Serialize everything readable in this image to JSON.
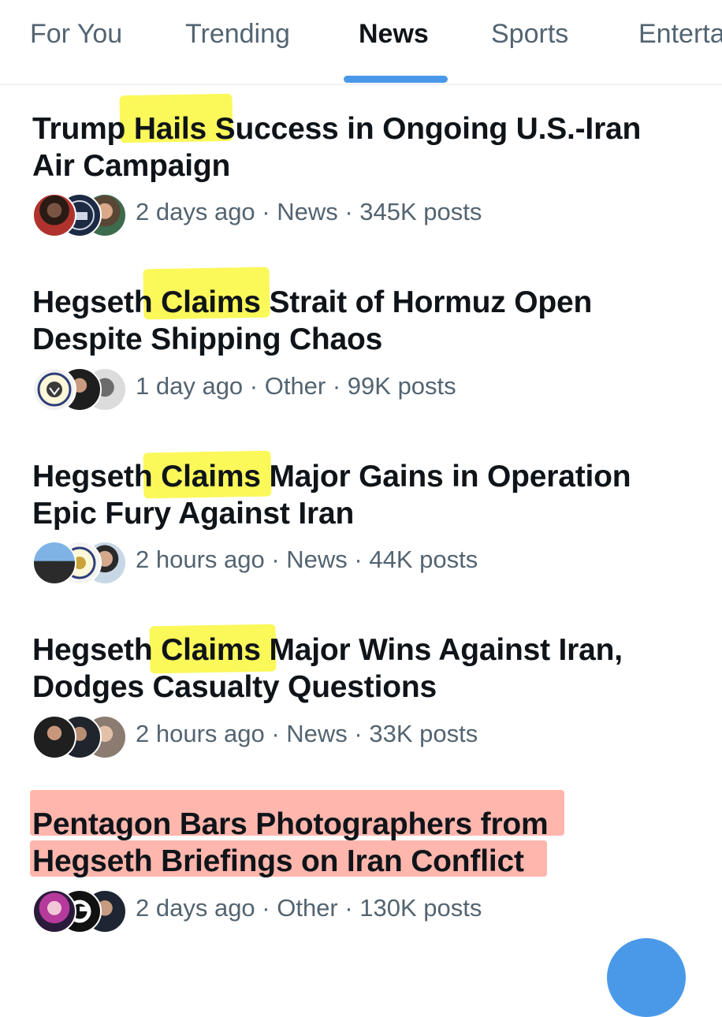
{
  "tabs": [
    {
      "label": "For You"
    },
    {
      "label": "Trending"
    },
    {
      "label": "News"
    },
    {
      "label": "Sports"
    },
    {
      "label": "Enterta"
    }
  ],
  "active_tab": "News",
  "accent_color": "#4a99e9",
  "highlight_colors": {
    "yellow": "#fbf85a",
    "red": "#ffb6ad"
  },
  "trends": [
    {
      "line1": [
        "Trump ",
        "Hails",
        " Success in Ongoing U.S.-Iran"
      ],
      "line2": "Air Campaign",
      "meta": "2 days ago · News · 345K posts",
      "avatars": [
        "person-avatar",
        "white-house-seal-avatar",
        "person-avatar"
      ]
    },
    {
      "line1": [
        "Hegseth ",
        "Claims",
        " Strait of Hormuz Open"
      ],
      "line2": "Despite Shipping Chaos",
      "meta": "1 day ago · Other · 99K posts",
      "avatars": [
        "seal-avatar",
        "person-avatar",
        "person-avatar"
      ]
    },
    {
      "line1": [
        "Hegseth ",
        "Claims",
        " Major Gains in Operation"
      ],
      "line2": "Epic Fury Against Iran",
      "meta": "2 hours ago · News · 44K posts",
      "avatars": [
        "person-avatar",
        "seal-avatar",
        "person-avatar"
      ]
    },
    {
      "line1": [
        "Hegseth ",
        "Claims",
        " Major Wins Against Iran,"
      ],
      "line2": "Dodges Casualty Questions",
      "meta": "2 hours ago · News · 33K posts",
      "avatars": [
        "person-avatar",
        "person-avatar",
        "person-avatar"
      ]
    },
    {
      "line1": [
        "Pentagon Bars Photographers from"
      ],
      "line2": "Hegseth Briefings on Iran Conflict",
      "meta": "2 days ago · Other · 130K posts",
      "avatars": [
        "illustrated-person-avatar",
        "logo-avatar",
        "person-avatar"
      ]
    }
  ]
}
